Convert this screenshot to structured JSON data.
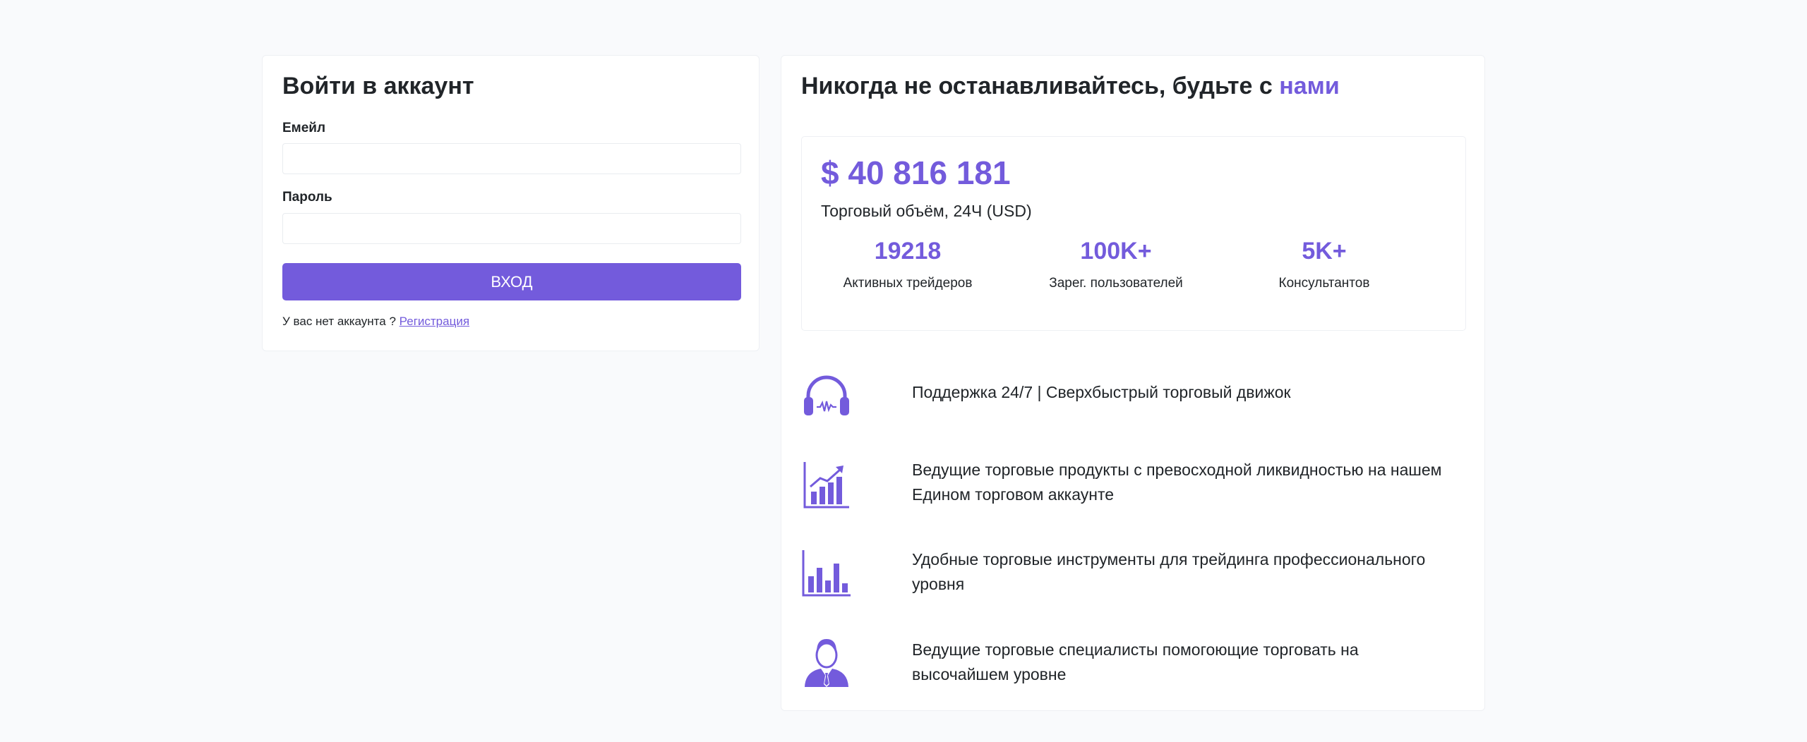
{
  "login": {
    "title": "Войти в аккаунт",
    "email_label": "Емейл",
    "email_value": "",
    "password_label": "Пароль",
    "password_value": "",
    "submit_label": "ВХОД",
    "no_account_text": "У вас нет аккаунта ?",
    "register_link": "Регистрация"
  },
  "promo": {
    "title_prefix": "Никогда не останавливайтесь, будьте с",
    "title_accent": "нами",
    "volume_value": "$ 40 816 181",
    "volume_label": "Торговый объём, 24Ч (USD)",
    "stats": [
      {
        "value": "19218",
        "label": "Активных трейдеров"
      },
      {
        "value": "100K+",
        "label": "Зарег. пользователей"
      },
      {
        "value": "5K+",
        "label": "Консультантов"
      }
    ],
    "features": [
      {
        "icon": "headset-icon",
        "text": "Поддержка 24/7 | Сверхбыстрый торговый движок"
      },
      {
        "icon": "growth-chart-icon",
        "text": "Ведущие торговые продукты с превосходной ликвидностью на нашем Едином торговом аккаунте"
      },
      {
        "icon": "bar-chart-icon",
        "text": "Удобные торговые инструменты для трейдинга профессионального уровня"
      },
      {
        "icon": "specialist-icon",
        "text": "Ведущие торговые специалисты помогоющие торговать на высочайшем уровне"
      }
    ]
  },
  "colors": {
    "accent": "#735bdc",
    "background": "#f9fafc",
    "card": "#ffffff",
    "text": "#212529"
  }
}
